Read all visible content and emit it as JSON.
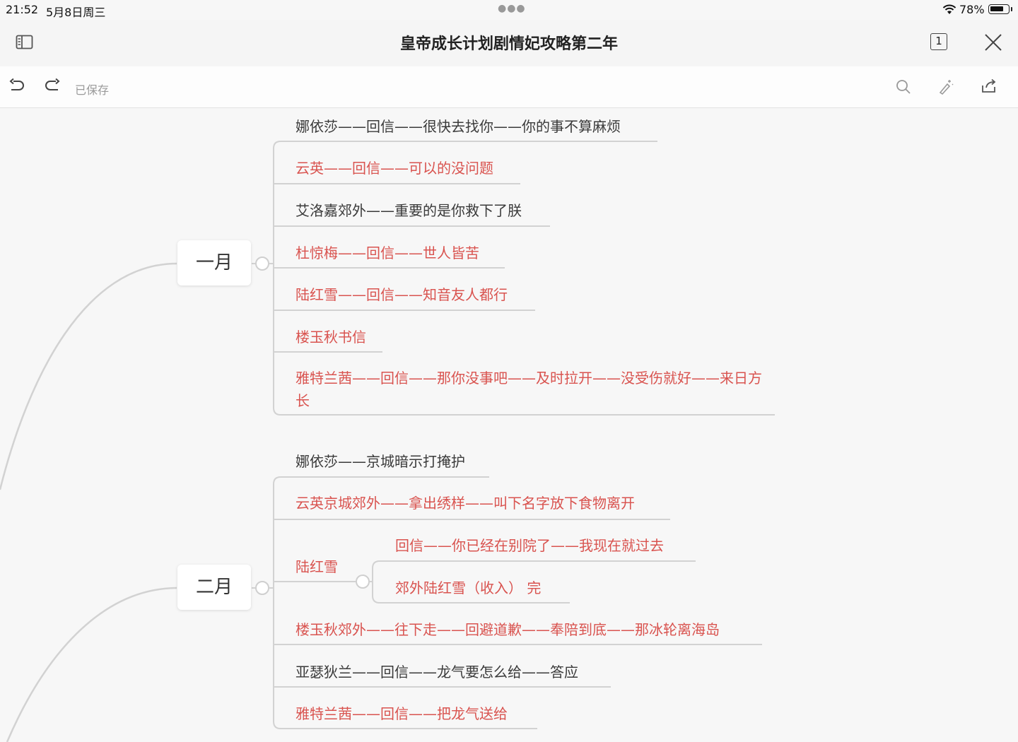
{
  "status_bar": {
    "time": "21:52",
    "date": "5月8日周三",
    "battery_percent": "78%",
    "battery_level": 0.78
  },
  "header": {
    "title": "皇帝成长计划剧情妃攻略第二年",
    "page_count": "1"
  },
  "toolbar": {
    "saved_label": "已保存"
  },
  "colors": {
    "red_text": "#d9534f",
    "black_text": "#3a3a3a",
    "line": "#cfcfcf"
  },
  "mindmap": {
    "january": {
      "label": "一月",
      "items": [
        {
          "text": "娜依莎——回信——很快去找你——你的事不算麻烦",
          "color": "black"
        },
        {
          "text": "云英——回信——可以的没问题",
          "color": "red"
        },
        {
          "text": "艾洛嘉郊外——重要的是你救下了朕",
          "color": "black"
        },
        {
          "text": "杜惊梅——回信——世人皆苦",
          "color": "red"
        },
        {
          "text": "陆红雪——回信——知音友人都行",
          "color": "red"
        },
        {
          "text": "楼玉秋书信",
          "color": "red"
        },
        {
          "text": "雅特兰茜——回信——那你没事吧——及时拉开——没受伤就好——来日方长",
          "color": "red"
        }
      ]
    },
    "february": {
      "label": "二月",
      "items": [
        {
          "text": "娜依莎——京城暗示打掩护",
          "color": "black"
        },
        {
          "text": "云英京城郊外——拿出绣样——叫下名字放下食物离开",
          "color": "red"
        },
        {
          "text": "陆红雪",
          "color": "red"
        },
        {
          "text": "楼玉秋郊外——往下走——回避道歉——奉陪到底——那冰轮离海岛",
          "color": "red"
        },
        {
          "text": "亚瑟狄兰——回信——龙气要怎么给——答应",
          "color": "black"
        },
        {
          "text": "雅特兰茜——回信——把龙气送给",
          "color": "red"
        }
      ],
      "sub_items": [
        {
          "text": "回信——你已经在别院了——我现在就过去",
          "color": "red"
        },
        {
          "text": "郊外陆红雪（收入） 完",
          "color": "red"
        }
      ]
    }
  }
}
